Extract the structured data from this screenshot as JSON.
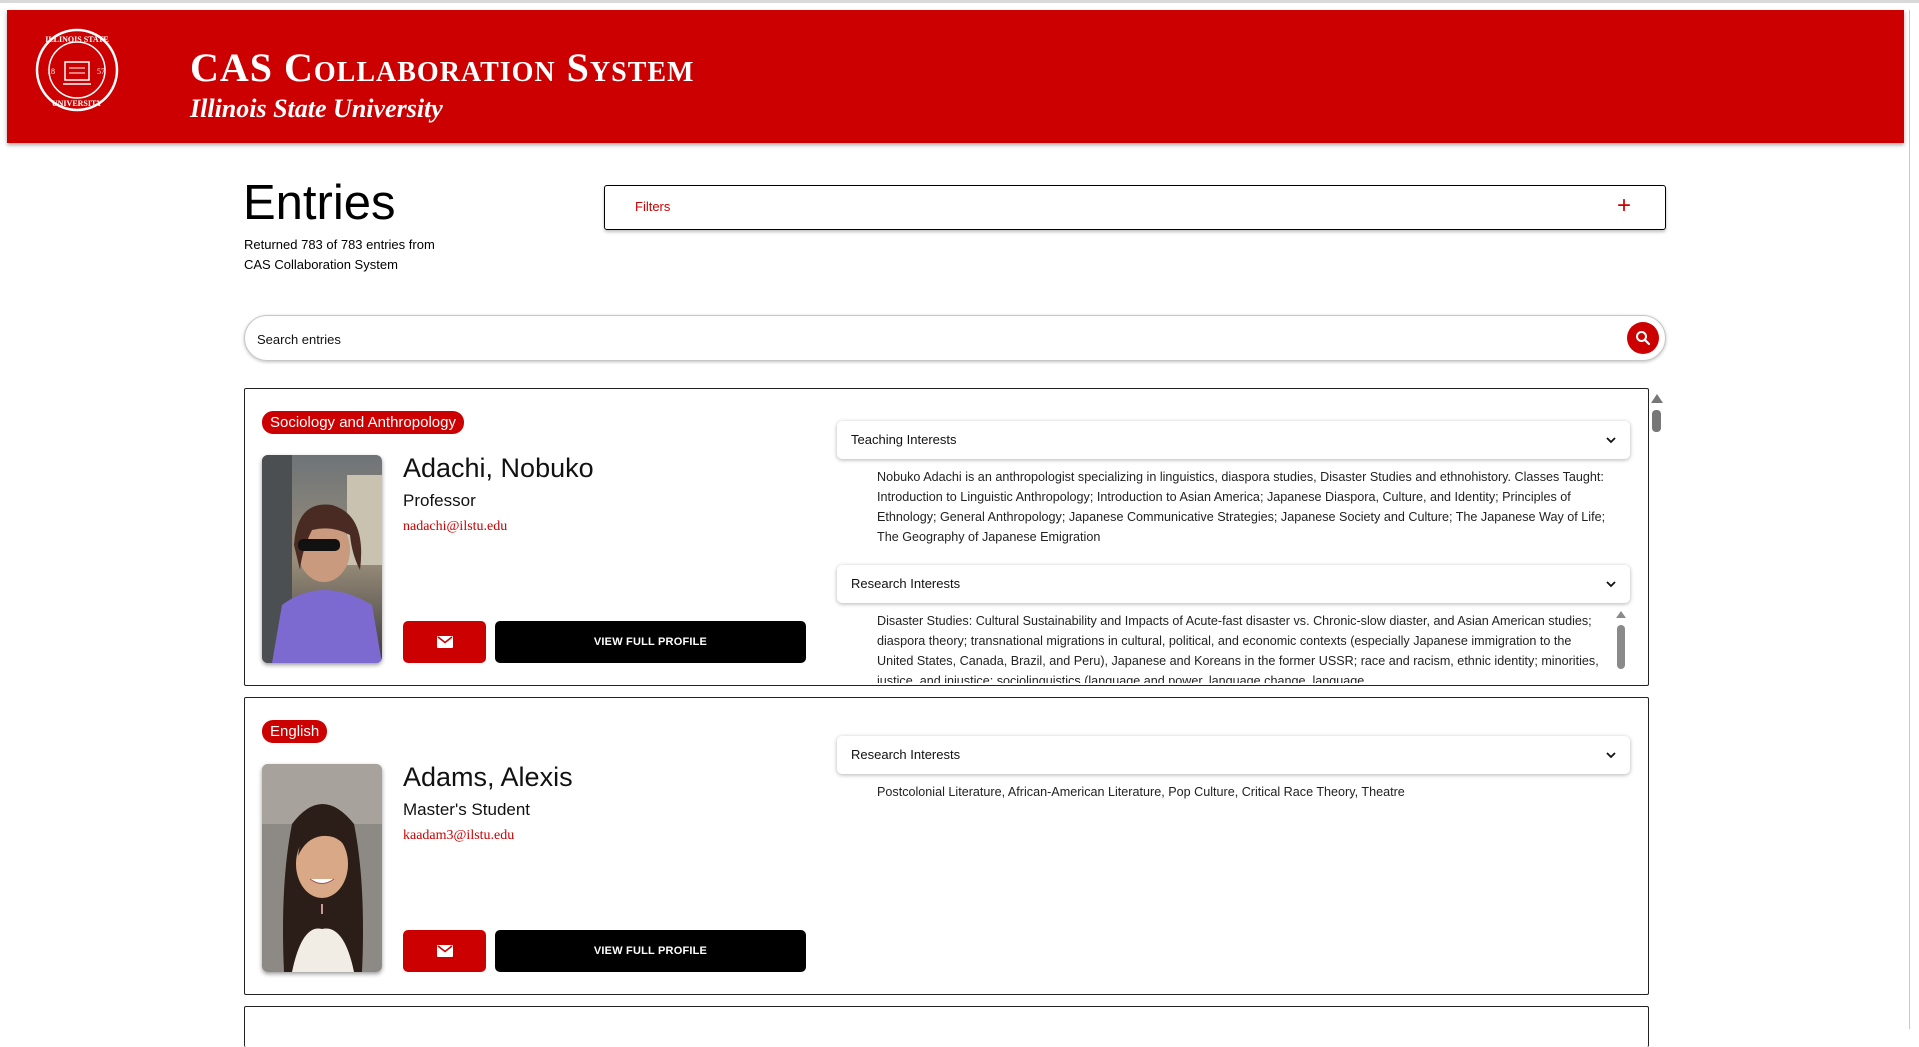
{
  "header": {
    "title": "CAS Collaboration System",
    "subtitle": "Illinois State University",
    "seal_text": "ILLINOIS STATE UNIVERSITY 1857"
  },
  "page": {
    "title": "Entries",
    "returned_line1": "Returned 783 of 783 entries from",
    "returned_line2": "CAS Collaboration System"
  },
  "filters": {
    "label": "Filters",
    "toggle_icon": "plus-icon"
  },
  "search": {
    "placeholder": "Search entries",
    "value": "",
    "button_icon": "search-icon"
  },
  "colors": {
    "accent": "#cc0000",
    "button_dark": "#000000"
  },
  "entries": [
    {
      "department": "Sociology and Anthropology",
      "name": "Adachi, Nobuko",
      "role": "Professor",
      "email": "nadachi@ilstu.edu",
      "profile_button": "VIEW FULL PROFILE",
      "sections": [
        {
          "label": "Teaching Interests",
          "text": "Nobuko Adachi is an anthropologist specializing in linguistics, diaspora studies, Disaster Studies and ethnohistory. Classes Taught: Introduction to Linguistic Anthropology; Introduction to Asian America; Japanese Diaspora, Culture, and Identity; Principles of Ethnology; General Anthropology; Japanese Communicative Strategies; Japanese Society and Culture; The Japanese Way of Life; The Geography of Japanese Emigration"
        },
        {
          "label": "Research Interests",
          "text": "Disaster Studies: Cultural Sustainability and Impacts of Acute-fast disaster vs. Chronic-slow diaster, and Asian American studies; diaspora theory; transnational migrations in cultural, political, and economic contexts (especially Japanese immigration to the United States, Canada, Brazil, and Peru), Japanese and Koreans in the former USSR; race and racism, ethnic identity; minorities, justice, and injustice; sociolinguistics (language and power, language change, language"
        }
      ]
    },
    {
      "department": "English",
      "name": "Adams, Alexis",
      "role": "Master's Student",
      "email": "kaadam3@ilstu.edu",
      "profile_button": "VIEW FULL PROFILE",
      "sections": [
        {
          "label": "Research Interests",
          "text": "Postcolonial Literature, African-American Literature, Pop Culture, Critical Race Theory, Theatre"
        }
      ]
    }
  ]
}
